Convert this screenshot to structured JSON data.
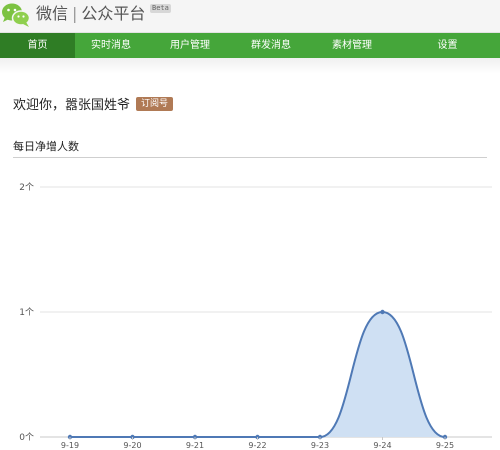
{
  "header": {
    "app_name": "微信",
    "section_name": "公众平台",
    "beta_tag": "Beta"
  },
  "nav": {
    "items": [
      {
        "label": "首页",
        "active": true
      },
      {
        "label": "实时消息",
        "active": false
      },
      {
        "label": "用户管理",
        "active": false
      },
      {
        "label": "群发消息",
        "active": false
      },
      {
        "label": "素材管理",
        "active": false
      },
      {
        "label": "设置",
        "active": false
      }
    ]
  },
  "welcome": {
    "text": "欢迎你，嚣张国姓爷",
    "account_type": "订阅号"
  },
  "stats": {
    "title": "每日净增人数"
  },
  "colors": {
    "nav_bg": "#45a63a",
    "nav_active": "#2f7d25",
    "line": "#4f79b5",
    "area_fill": "#cfe0f3",
    "badge": "#b07a55"
  },
  "chart_data": {
    "type": "area",
    "title": "每日净增人数",
    "x": [
      "9-19",
      "9-20",
      "9-21",
      "9-22",
      "9-23",
      "9-24",
      "9-25"
    ],
    "series": [
      {
        "values": [
          0,
          0,
          0,
          0,
          0,
          1,
          0
        ]
      }
    ],
    "ytick_labels": [
      "0个",
      "1个",
      "2个"
    ],
    "ylim": [
      0,
      2
    ],
    "grid": true,
    "xlabel": "",
    "ylabel": ""
  }
}
